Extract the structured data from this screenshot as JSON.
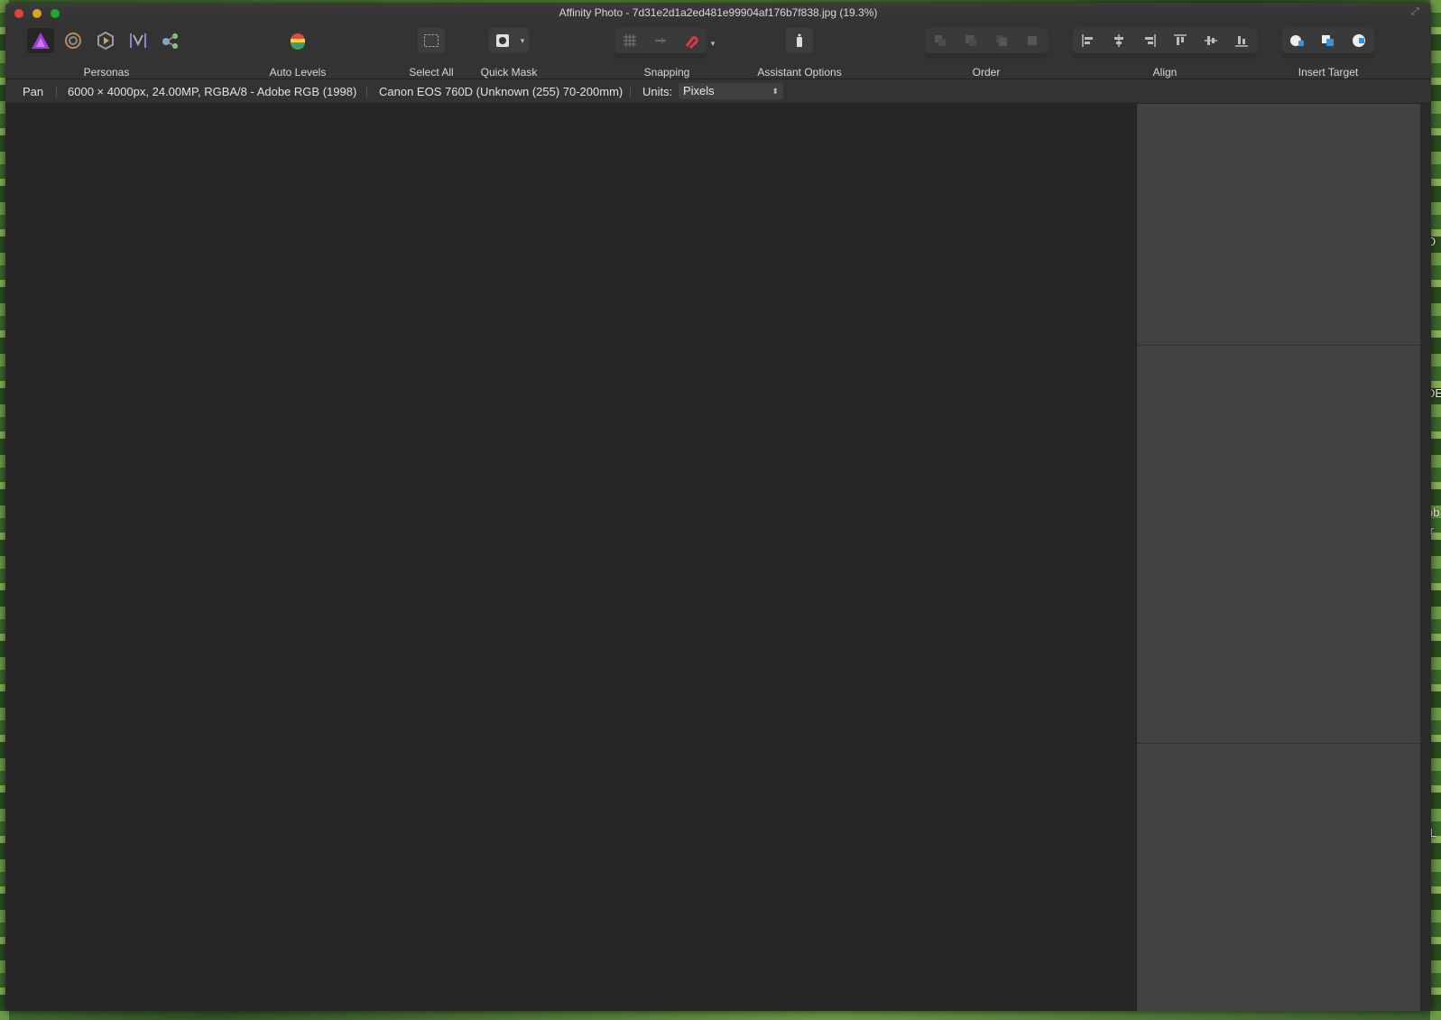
{
  "window": {
    "title": "Affinity Photo - 7d31e2d1a2ed481e99904af176b7f838.jpg (19.3%)"
  },
  "toolbar": {
    "personas_label": "Personas",
    "auto_levels_label": "Auto Levels",
    "select_all_label": "Select All",
    "quick_mask_label": "Quick Mask",
    "snapping_label": "Snapping",
    "assistant_options_label": "Assistant Options",
    "order_label": "Order",
    "align_label": "Align",
    "insert_target_label": "Insert Target"
  },
  "context": {
    "tool": "Pan",
    "image_info": "6000 × 4000px, 24.00MP, RGBA/8 - Adobe RGB (1998)",
    "camera_info": "Canon EOS 760D (Unknown (255) 70-200mm)",
    "units_label": "Units:",
    "units_value": "Pixels"
  },
  "desktop": {
    "edge_labels": [
      "O",
      "DE",
      "ob",
      ".r",
      ".L"
    ]
  },
  "colors": {
    "persona_accent": "#9b3fd6",
    "snapping_magnet": "#d93a4a"
  }
}
